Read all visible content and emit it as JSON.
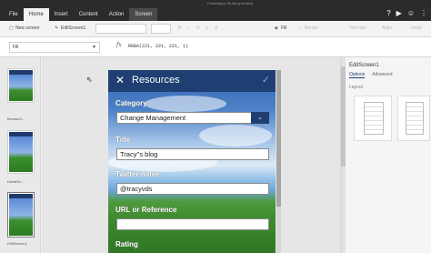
{
  "titlebar": {
    "text": "PowerApps Studio (preview)"
  },
  "tabs": [
    {
      "label": "File"
    },
    {
      "label": "Home"
    },
    {
      "label": "Insert"
    },
    {
      "label": "Content"
    },
    {
      "label": "Action"
    },
    {
      "label": "Screen"
    }
  ],
  "top_icons": [
    "help-icon",
    "play-icon",
    "user-icon",
    "grid-icon"
  ],
  "ribbon": {
    "new_screen": "New screen",
    "screen_name": "EditScreen1",
    "fill": "Fill",
    "border": "Border",
    "reorder": "Reorder",
    "align": "Align",
    "undo": "Undo"
  },
  "formula_bar": {
    "property": "Fill",
    "fx": "fx",
    "formula": "RGBA(221, 221, 221, 1)"
  },
  "screens": [
    {
      "label": "BrowseS..."
    },
    {
      "label": "DetailSc..."
    },
    {
      "label": "EditScreen1"
    }
  ],
  "app": {
    "title": "Resources",
    "close_icon": "close-icon",
    "check_icon": "check-icon",
    "fields": {
      "category_label": "Category",
      "category_value": "Change Management",
      "title_label": "Title",
      "title_value": "Tracy''s blog",
      "twitter_label": "Twitter name",
      "twitter_value": "@tracyvds",
      "url_label": "URL or Reference",
      "url_value": "",
      "rating_label": "Rating"
    }
  },
  "right_panel": {
    "title": "EditScreen1",
    "tabs": [
      {
        "label": "Options"
      },
      {
        "label": "Advanced"
      }
    ],
    "section": "Layout"
  }
}
